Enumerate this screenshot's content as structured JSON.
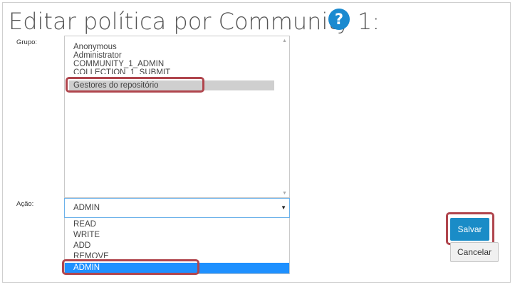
{
  "page": {
    "title": "Editar política por Community 1:",
    "help_icon": "?"
  },
  "group_field": {
    "label": "Grupo:",
    "options": [
      "Anonymous",
      "Administrator",
      "COMMUNITY_1_ADMIN",
      "COLLECTION_1_SUBMIT",
      "Gestores do repositório"
    ],
    "selected": "Gestores do repositório"
  },
  "action_field": {
    "label": "Ação:",
    "value": "ADMIN",
    "options": [
      "READ",
      "WRITE",
      "ADD",
      "REMOVE",
      "ADMIN"
    ],
    "highlighted": "ADMIN"
  },
  "buttons": {
    "save_label": "Salvar",
    "cancel_label": "Cancelar"
  },
  "colors": {
    "accent": "#1a8cc7",
    "highlight_outline": "#b0454d",
    "dropdown_active": "#1e90ff"
  }
}
